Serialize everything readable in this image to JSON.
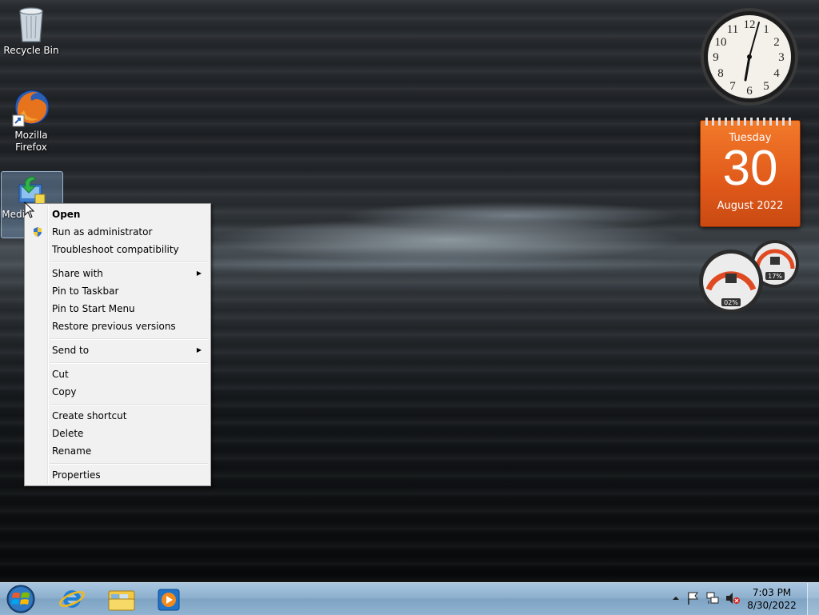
{
  "desktop": {
    "icons": [
      {
        "label": "Recycle Bin"
      },
      {
        "label": "Mozilla Firefox"
      },
      {
        "label": "Medi... nTo..."
      }
    ]
  },
  "gadgets": {
    "clock": {
      "numbers": [
        "12",
        "1",
        "2",
        "3",
        "4",
        "5",
        "6",
        "7",
        "8",
        "9",
        "10",
        "11"
      ]
    },
    "calendar": {
      "weekday": "Tuesday",
      "day": "30",
      "month_year": "August 2022"
    },
    "meter": {
      "cpu": "02%",
      "memory": "17%"
    }
  },
  "context_menu": {
    "items": [
      {
        "label": "Open"
      },
      {
        "label": "Run as administrator"
      },
      {
        "label": "Troubleshoot compatibility"
      },
      {
        "label": "Share with"
      },
      {
        "label": "Pin to Taskbar"
      },
      {
        "label": "Pin to Start Menu"
      },
      {
        "label": "Restore previous versions"
      },
      {
        "label": "Send to"
      },
      {
        "label": "Cut"
      },
      {
        "label": "Copy"
      },
      {
        "label": "Create shortcut"
      },
      {
        "label": "Delete"
      },
      {
        "label": "Rename"
      },
      {
        "label": "Properties"
      }
    ]
  },
  "taskbar": {
    "pinned": [
      "internet-explorer-icon",
      "windows-explorer-icon",
      "media-player-icon"
    ],
    "tray": {
      "time": "7:03 PM",
      "date": "8/30/2022"
    }
  }
}
